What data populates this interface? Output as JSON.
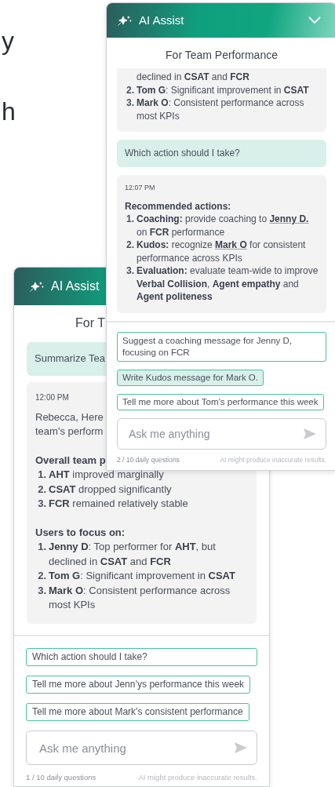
{
  "background_text": [
    "y",
    "h"
  ],
  "panels": [
    {
      "title": "AI Assist",
      "subtitle": "For T",
      "messages": [
        {
          "kind": "user",
          "text": "Summarize Tea"
        },
        {
          "kind": "assistant",
          "time": "12:00 PM",
          "blocks": [
            {
              "kind": "lines",
              "lines": [
                "Rebecca, Here",
                "team's perform"
              ]
            },
            {
              "kind": "heading",
              "text": "Overall team p"
            },
            {
              "kind": "list",
              "items": [
                {
                  "number": "1.",
                  "parts": [
                    {
                      "text": "**AHT** improved marginally"
                    }
                  ]
                },
                {
                  "number": "2.",
                  "parts": [
                    {
                      "text": "**CSAT** dropped significantly"
                    }
                  ]
                },
                {
                  "number": "3.",
                  "parts": [
                    {
                      "text": "**FCR** remained relatively stable"
                    }
                  ]
                }
              ]
            },
            {
              "kind": "heading",
              "text": "Users to focus on:"
            },
            {
              "kind": "list",
              "items": [
                {
                  "number": "1.",
                  "parts": [
                    {
                      "text": "**Jenny D**: Top performer for **AHT**, but declined in **CSAT** and **FCR**"
                    }
                  ]
                },
                {
                  "number": "2.",
                  "parts": [
                    {
                      "text": "**Tom G**: Significant improvement in **CSAT**"
                    }
                  ]
                },
                {
                  "number": "3.",
                  "parts": [
                    {
                      "text": "**Mark O**: Consistent performance across most KPIs"
                    }
                  ]
                }
              ]
            }
          ]
        }
      ],
      "suggestions": [
        {
          "text": "Which action should I take?",
          "selected": false
        },
        {
          "text": "Tell me more about Jenn’ys performance this week",
          "selected": false
        },
        {
          "text": "Tell me more about Mark’s consistent performance",
          "selected": false
        }
      ],
      "input": {
        "placeholder": "Ask me anything"
      },
      "quota": "1 / 10 daily questions",
      "disclaimer": "AI might produce inaccurate results."
    },
    {
      "title": "AI Assist",
      "collapse_button": true,
      "subtitle": "For Team Performance",
      "messages": [
        {
          "kind": "assistant",
          "blocks": [
            {
              "kind": "continued",
              "text": "declined in **CSAT** and **FCR**"
            },
            {
              "kind": "list",
              "items": [
                {
                  "number": "2.",
                  "parts": [
                    {
                      "text": "**Tom G**: Significant improvement in **CSAT**"
                    }
                  ]
                },
                {
                  "number": "3.",
                  "parts": [
                    {
                      "text": "**Mark O**: Consistent performance across most KPIs"
                    }
                  ]
                }
              ]
            }
          ]
        },
        {
          "kind": "user",
          "text": "Which action should I take?"
        },
        {
          "kind": "assistant",
          "time": "12:07 PM",
          "blocks": [
            {
              "kind": "heading",
              "text": "Recommended actions:"
            },
            {
              "kind": "list",
              "items": [
                {
                  "number": "1.",
                  "parts": [
                    {
                      "text": "**Coaching:** provide coaching to "
                    },
                    {
                      "link": "Jenny D."
                    },
                    {
                      "text": " on **FCR** performance"
                    }
                  ]
                },
                {
                  "number": "2.",
                  "parts": [
                    {
                      "text": "**Kudos:** recognize "
                    },
                    {
                      "link": "Mark O"
                    },
                    {
                      "text": " for consistent performance across KPIs"
                    }
                  ]
                },
                {
                  "number": "3.",
                  "parts": [
                    {
                      "text": "**Evaluation:** evaluate team-wide to improve **Verbal Collision**, **Agent empathy** and **Agent politeness**"
                    }
                  ]
                }
              ]
            }
          ]
        }
      ],
      "suggestions": [
        {
          "text": "Suggest a coaching message for Jenny D, focusing on FCR",
          "selected": false
        },
        {
          "text": "Write Kudos message for Mark O.",
          "selected": true
        },
        {
          "text": "Tell me more about Tom’s performance this week",
          "selected": false
        }
      ],
      "input": {
        "placeholder": "Ask me anything"
      },
      "quota": "2 / 10 daily questions",
      "disclaimer": "AI might produce inaccurate results."
    }
  ]
}
